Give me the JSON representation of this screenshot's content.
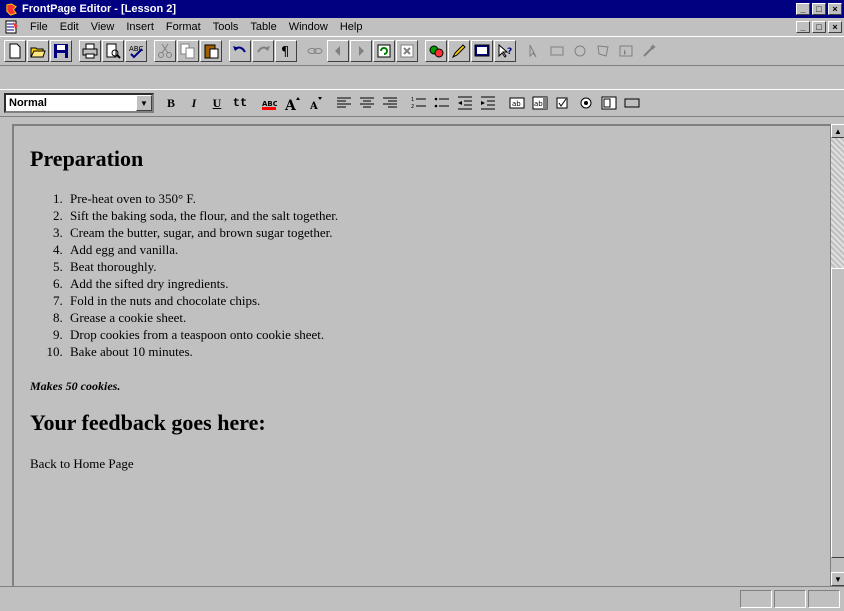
{
  "window": {
    "title": "FrontPage Editor - [Lesson 2]",
    "btn_minimize": "_",
    "btn_restore": "□",
    "btn_close": "×"
  },
  "menu": {
    "items": [
      "File",
      "Edit",
      "View",
      "Insert",
      "Format",
      "Tools",
      "Table",
      "Window",
      "Help"
    ]
  },
  "format_toolbar": {
    "style_value": "Normal",
    "bold": "B",
    "italic": "I",
    "underline": "U",
    "typewriter": "tt"
  },
  "document": {
    "heading_preparation": "Preparation",
    "steps": [
      "Pre-heat oven to 350° F.",
      "Sift the baking soda, the flour, and the salt together.",
      "Cream the butter, sugar, and brown sugar together.",
      "Add egg and vanilla.",
      "Beat thoroughly.",
      "Add the sifted dry ingredients.",
      "Fold in the nuts and chocolate chips.",
      "Grease a cookie sheet.",
      "Drop cookies from a teaspoon onto cookie sheet.",
      "Bake about 10 minutes."
    ],
    "makes": "Makes 50 cookies.",
    "heading_feedback": "Your feedback goes here:",
    "back_link": "Back to Home Page"
  }
}
